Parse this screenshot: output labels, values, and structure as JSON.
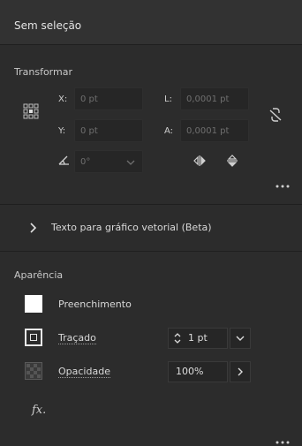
{
  "header": {
    "title": "Sem seleção"
  },
  "transform": {
    "label": "Transformar",
    "x_label": "X:",
    "x_value": "0 pt",
    "y_label": "Y:",
    "y_value": "0 pt",
    "w_label": "L:",
    "w_value": "0,0001 pt",
    "h_label": "A:",
    "h_value": "0,0001 pt",
    "angle_value": "0°"
  },
  "vector_text": {
    "label": "Texto para gráfico vetorial (Beta)"
  },
  "appearance": {
    "label": "Aparência",
    "fill_label": "Preenchimento",
    "stroke_label": "Traçado",
    "stroke_weight": "1 pt",
    "opacity_label": "Opacidade",
    "opacity_value": "100%",
    "fx_label": "fx."
  },
  "colors": {
    "fill_swatch": "#ffffff",
    "panel_bg": "#2c2c2c"
  },
  "icons": [
    "reference-point-icon",
    "link-proportions-icon",
    "angle-icon",
    "flip-horizontal-icon",
    "flip-vertical-icon",
    "more-options-icon",
    "chevron-right-icon",
    "stepper-icon",
    "chevron-down-icon",
    "fx-icon"
  ]
}
